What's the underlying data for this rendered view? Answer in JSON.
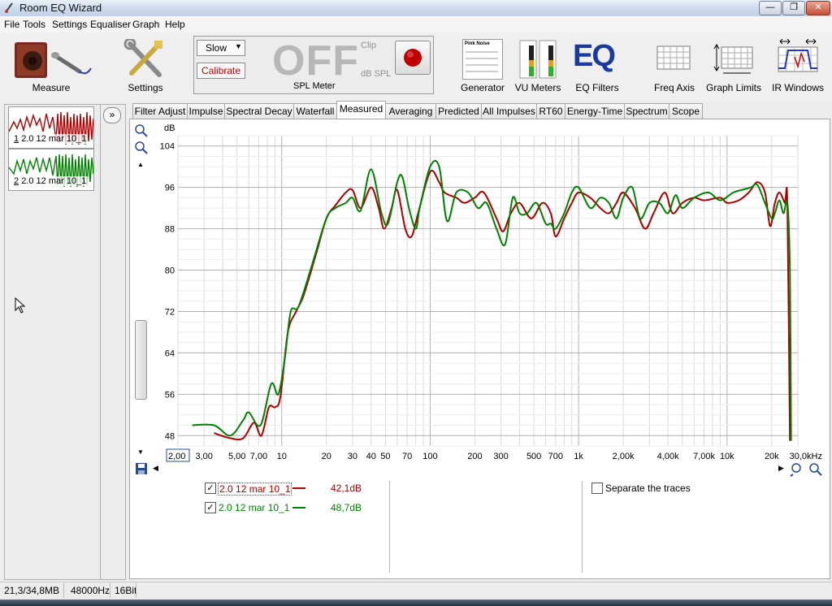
{
  "window": {
    "title": "Room EQ Wizard"
  },
  "menu": [
    "File",
    "Tools",
    "Settings",
    "Equaliser",
    "Graph",
    "Help"
  ],
  "toolbar": {
    "measure": "Measure",
    "settings": "Settings",
    "speed": "Slow",
    "calibrate": "Calibrate",
    "spl_state": "OFF",
    "clip": "Clip",
    "spl_unit": "dB SPL",
    "spl_label": "SPL Meter",
    "generator": "Generator",
    "generator_signal": "Pink Noise",
    "vu_meters": "VU Meters",
    "eq_logo": "EQ",
    "eq_filters": "EQ Filters",
    "freq_axis": "Freq Axis",
    "graph_limits": "Graph Limits",
    "ir_windows": "IR Windows"
  },
  "measurements": [
    {
      "index": "1",
      "name": "2.0 12 mar 10_1",
      "color": "#aa0000"
    },
    {
      "index": "2",
      "name": "2.0 12 mar 10_1",
      "color": "#008000"
    }
  ],
  "tabs": [
    "Filter Adjust",
    "Impulse",
    "Spectral Decay",
    "Waterfall",
    "Measured",
    "Averaging",
    "Predicted",
    "All Impulses",
    "RT60",
    "Energy-Time",
    "Spectrum",
    "Scope"
  ],
  "active_tab": "Measured",
  "legend": {
    "rows": [
      {
        "name": "2.0 12 mar 10_1",
        "value": "42,1dB",
        "color": "#aa0000",
        "checked": true
      },
      {
        "name": "2.0 12 mar 10_1",
        "value": "48,7dB",
        "color": "#008000",
        "checked": true
      }
    ],
    "separate_traces": "Separate the traces"
  },
  "status": {
    "memory": "21,3/34,8MB",
    "sample_rate": "48000Hz",
    "bits": "16Bit"
  },
  "chart_data": {
    "type": "line",
    "ylabel": "dB",
    "xlabel": "",
    "x_scale": "log",
    "xlim": [
      2,
      30000
    ],
    "ylim": [
      46,
      106
    ],
    "grid": true,
    "x_tick_labels": [
      {
        "v": 2,
        "t": "2,00"
      },
      {
        "v": 3,
        "t": "3,00"
      },
      {
        "v": 5,
        "t": "5,00"
      },
      {
        "v": 7,
        "t": "7,00"
      },
      {
        "v": 10,
        "t": "10"
      },
      {
        "v": 20,
        "t": "20"
      },
      {
        "v": 30,
        "t": "30"
      },
      {
        "v": 40,
        "t": "40"
      },
      {
        "v": 50,
        "t": "50"
      },
      {
        "v": 70,
        "t": "70"
      },
      {
        "v": 100,
        "t": "100"
      },
      {
        "v": 200,
        "t": "200"
      },
      {
        "v": 300,
        "t": "300"
      },
      {
        "v": 500,
        "t": "500"
      },
      {
        "v": 700,
        "t": "700"
      },
      {
        "v": 1000,
        "t": "1k"
      },
      {
        "v": 2000,
        "t": "2,00k"
      },
      {
        "v": 4000,
        "t": "4,00k"
      },
      {
        "v": 7000,
        "t": "7,00k"
      },
      {
        "v": 10000,
        "t": "10k"
      },
      {
        "v": 20000,
        "t": "20k"
      },
      {
        "v": 30000,
        "t": "30,0kHz"
      }
    ],
    "y_ticks": [
      48,
      56,
      64,
      72,
      80,
      88,
      96,
      104
    ],
    "series": [
      {
        "name": "2.0 12 mar 10_1",
        "color": "#aa0000",
        "points": [
          [
            3.5,
            48.5
          ],
          [
            4.5,
            47.5
          ],
          [
            5.5,
            47.5
          ],
          [
            6.5,
            50.5
          ],
          [
            7.3,
            48
          ],
          [
            8.2,
            53.5
          ],
          [
            9,
            53.5
          ],
          [
            9.8,
            55.5
          ],
          [
            11,
            68
          ],
          [
            12.5,
            72
          ],
          [
            14,
            75
          ],
          [
            17,
            83
          ],
          [
            20,
            90
          ],
          [
            23,
            92.5
          ],
          [
            27,
            95
          ],
          [
            30,
            95.5
          ],
          [
            34,
            92
          ],
          [
            40,
            96
          ],
          [
            45,
            92
          ],
          [
            49,
            88
          ],
          [
            55,
            92
          ],
          [
            60,
            95.5
          ],
          [
            68,
            88
          ],
          [
            75,
            86.5
          ],
          [
            83,
            91
          ],
          [
            100,
            99
          ],
          [
            115,
            97
          ],
          [
            125,
            95
          ],
          [
            150,
            94
          ],
          [
            170,
            93
          ],
          [
            200,
            94
          ],
          [
            230,
            95
          ],
          [
            280,
            90
          ],
          [
            310,
            87.5
          ],
          [
            350,
            91
          ],
          [
            400,
            93
          ],
          [
            480,
            90
          ],
          [
            570,
            93
          ],
          [
            650,
            91
          ],
          [
            700,
            86.5
          ],
          [
            800,
            90
          ],
          [
            900,
            93
          ],
          [
            1000,
            95
          ],
          [
            1200,
            94
          ],
          [
            1400,
            92
          ],
          [
            1600,
            91
          ],
          [
            1800,
            93
          ],
          [
            2000,
            95
          ],
          [
            2400,
            92
          ],
          [
            2800,
            88
          ],
          [
            3200,
            91
          ],
          [
            3800,
            95
          ],
          [
            4300,
            91
          ],
          [
            5000,
            93
          ],
          [
            6000,
            94
          ],
          [
            7000,
            93.5
          ],
          [
            9000,
            94
          ],
          [
            10000,
            93
          ],
          [
            12000,
            93.5
          ],
          [
            14000,
            95
          ],
          [
            16000,
            97
          ],
          [
            18000,
            95
          ],
          [
            19500,
            88.5
          ],
          [
            21000,
            93
          ],
          [
            22500,
            95
          ],
          [
            24500,
            93
          ],
          [
            25500,
            92.5
          ],
          [
            26500,
            47
          ]
        ]
      },
      {
        "name": "2.0 12 mar 10_1",
        "color": "#008000",
        "points": [
          [
            2.5,
            50
          ],
          [
            3.5,
            50
          ],
          [
            4.5,
            48
          ],
          [
            5.5,
            51
          ],
          [
            6,
            52.5
          ],
          [
            7.2,
            50
          ],
          [
            8.5,
            58
          ],
          [
            9.5,
            56
          ],
          [
            10.5,
            63
          ],
          [
            11.5,
            72
          ],
          [
            13,
            73
          ],
          [
            16,
            81
          ],
          [
            20,
            90
          ],
          [
            23,
            92
          ],
          [
            27,
            93
          ],
          [
            30,
            94
          ],
          [
            34,
            91.5
          ],
          [
            40,
            99.5
          ],
          [
            47,
            91
          ],
          [
            52,
            89
          ],
          [
            60,
            97
          ],
          [
            65,
            98
          ],
          [
            72,
            92
          ],
          [
            80,
            88
          ],
          [
            85,
            92
          ],
          [
            100,
            100
          ],
          [
            115,
            100
          ],
          [
            130,
            89.5
          ],
          [
            150,
            95
          ],
          [
            180,
            95
          ],
          [
            210,
            92
          ],
          [
            240,
            93
          ],
          [
            280,
            88
          ],
          [
            320,
            85
          ],
          [
            360,
            94
          ],
          [
            400,
            91
          ],
          [
            450,
            91
          ],
          [
            520,
            93
          ],
          [
            600,
            89
          ],
          [
            650,
            89
          ],
          [
            700,
            88
          ],
          [
            800,
            91
          ],
          [
            900,
            95
          ],
          [
            1000,
            96
          ],
          [
            1200,
            92
          ],
          [
            1400,
            94
          ],
          [
            1600,
            93
          ],
          [
            1800,
            90
          ],
          [
            2000,
            94
          ],
          [
            2300,
            96
          ],
          [
            2600,
            90
          ],
          [
            3000,
            93
          ],
          [
            3500,
            93
          ],
          [
            4000,
            91
          ],
          [
            4500,
            94.5
          ],
          [
            5000,
            92
          ],
          [
            6000,
            94
          ],
          [
            7500,
            95
          ],
          [
            9000,
            93.5
          ],
          [
            11000,
            95
          ],
          [
            12500,
            95.5
          ],
          [
            14500,
            96
          ],
          [
            16000,
            96.5
          ],
          [
            18000,
            93
          ],
          [
            20000,
            90
          ],
          [
            21000,
            91
          ],
          [
            22500,
            93.5
          ],
          [
            24000,
            91
          ],
          [
            25500,
            93
          ],
          [
            26500,
            80
          ],
          [
            27000,
            47
          ]
        ]
      }
    ]
  }
}
